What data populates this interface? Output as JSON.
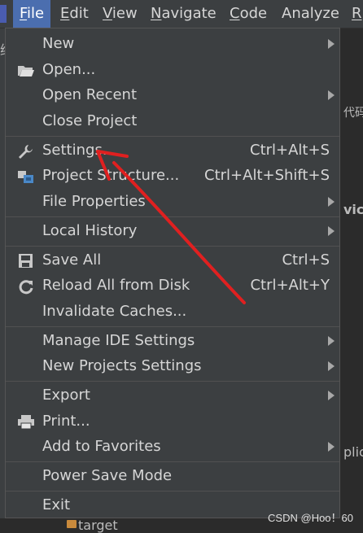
{
  "menubar": {
    "items": [
      {
        "label": "File",
        "mnemonic": "F",
        "rest": "ile"
      },
      {
        "label": "Edit",
        "mnemonic": "E",
        "rest": "dit"
      },
      {
        "label": "View",
        "mnemonic": "V",
        "rest": "iew"
      },
      {
        "label": "Navigate",
        "mnemonic": "N",
        "rest": "avigate"
      },
      {
        "label": "Code",
        "mnemonic": "C",
        "rest": "ode"
      },
      {
        "label": "Analyze",
        "mnemonic": "",
        "rest": "Analyze"
      },
      {
        "label": "R",
        "mnemonic": "R",
        "rest": ""
      }
    ]
  },
  "menu": {
    "new": "New",
    "open": "Open...",
    "open_recent": "Open Recent",
    "close_project": "Close Project",
    "settings": "Settings...",
    "settings_shortcut": "Ctrl+Alt+S",
    "project_structure": "Project Structure...",
    "project_structure_shortcut": "Ctrl+Alt+Shift+S",
    "file_properties": "File Properties",
    "local_history": "Local History",
    "save_all": "Save All",
    "save_all_shortcut": "Ctrl+S",
    "reload_all": "Reload All from Disk",
    "reload_all_shortcut": "Ctrl+Alt+Y",
    "invalidate_caches": "Invalidate Caches...",
    "manage_ide_settings": "Manage IDE Settings",
    "new_projects_settings": "New Projects Settings",
    "export": "Export",
    "print": "Print...",
    "add_to_favorites": "Add to Favorites",
    "power_save_mode": "Power Save Mode",
    "exit": "Exit"
  },
  "background": {
    "right_texts": [
      "代码",
      "vic",
      "plic"
    ],
    "left_char": "纲",
    "target_label": "target"
  },
  "watermark": "CSDN @Hoo！60",
  "colors": {
    "menu_bg": "#3c3f41",
    "active_menu": "#4b6eaf",
    "annotation_arrow": "#e02020"
  }
}
